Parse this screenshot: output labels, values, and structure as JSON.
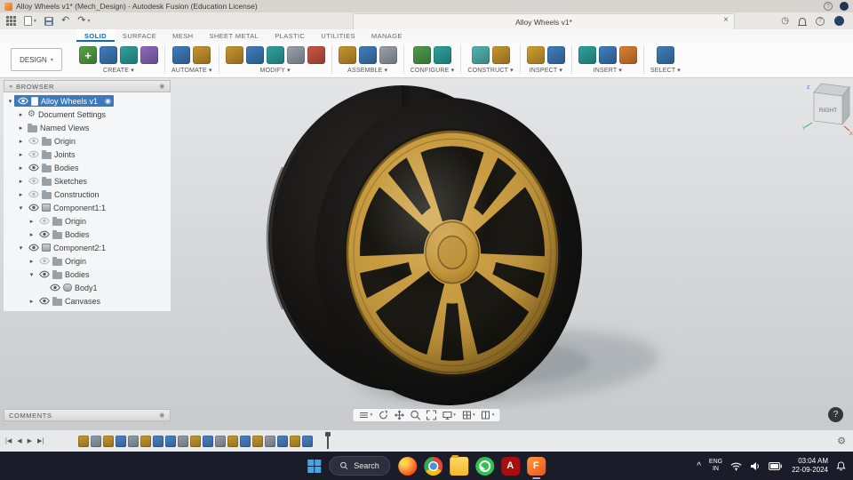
{
  "window": {
    "title": "Alloy Wheels v1* (Mech_Design) - Autodesk Fusion (Education License)"
  },
  "quickbar": {
    "tab": "Alloy Wheels v1*",
    "close_glyph": "×",
    "undo_glyph": "↶",
    "redo_glyph": "↷",
    "grid_menu": "app-grid",
    "clock_glyph": "◷"
  },
  "ribbon": {
    "workspace": "DESIGN",
    "workspace_caret": "▾",
    "tabs": [
      {
        "label": "SOLID",
        "active": true
      },
      {
        "label": "SURFACE"
      },
      {
        "label": "MESH"
      },
      {
        "label": "SHEET METAL"
      },
      {
        "label": "PLASTIC"
      },
      {
        "label": "UTILITIES"
      },
      {
        "label": "MANAGE"
      }
    ],
    "groups": [
      {
        "label": "CREATE",
        "icons": [
          {
            "name": "create-sketch",
            "color": "#55a546",
            "glyph": "+"
          },
          {
            "name": "extrude",
            "color": "#3f7fbf"
          },
          {
            "name": "revolve",
            "color": "#2fa3a0"
          },
          {
            "name": "create-form",
            "color": "#8f6abf"
          }
        ]
      },
      {
        "label": "AUTOMATE",
        "icons": [
          {
            "name": "automated-modeling",
            "color": "#3f7fbf"
          },
          {
            "name": "scripts-addins",
            "color": "#c9972f"
          }
        ]
      },
      {
        "label": "MODIFY",
        "icons": [
          {
            "name": "press-pull",
            "color": "#c9972f"
          },
          {
            "name": "fillet",
            "color": "#3f7fbf"
          },
          {
            "name": "shell",
            "color": "#2fa3a0"
          },
          {
            "name": "combine",
            "color": "#9aa2ab"
          },
          {
            "name": "move-copy",
            "color": "#cc5544"
          }
        ]
      },
      {
        "label": "ASSEMBLE",
        "icons": [
          {
            "name": "new-component",
            "color": "#c9972f"
          },
          {
            "name": "joint",
            "color": "#3f7fbf"
          },
          {
            "name": "rigid-group",
            "color": "#9aa2ab"
          }
        ]
      },
      {
        "label": "CONFIGURE",
        "icons": [
          {
            "name": "configuration",
            "color": "#4f9e4c"
          },
          {
            "name": "configure-table",
            "color": "#2fa3a0"
          }
        ]
      },
      {
        "label": "CONSTRUCT",
        "icons": [
          {
            "name": "construction-plane",
            "color": "#53b7b4"
          },
          {
            "name": "construction-axis",
            "color": "#c9972f"
          }
        ]
      },
      {
        "label": "INSPECT",
        "icons": [
          {
            "name": "measure",
            "color": "#d1a02f"
          },
          {
            "name": "section-analysis",
            "color": "#3f7fbf"
          }
        ]
      },
      {
        "label": "INSERT",
        "icons": [
          {
            "name": "insert-derive",
            "color": "#2fa3a0"
          },
          {
            "name": "decal",
            "color": "#3f7fbf"
          },
          {
            "name": "canvas",
            "color": "#e08030"
          }
        ]
      },
      {
        "label": "SELECT",
        "icons": [
          {
            "name": "select-tool",
            "color": "#3f7fbf"
          }
        ]
      }
    ]
  },
  "browser": {
    "header": "BROWSER",
    "items": [
      {
        "label": "Alloy Wheels v1",
        "level": 0,
        "icon": "document",
        "expand": "open",
        "eye": "on",
        "selected": true,
        "badge": true
      },
      {
        "label": "Document Settings",
        "level": 1,
        "icon": "gear",
        "expand": "closed",
        "eye": null
      },
      {
        "label": "Named Views",
        "level": 1,
        "icon": "folder",
        "expand": "closed",
        "eye": null
      },
      {
        "label": "Origin",
        "level": 1,
        "icon": "folder",
        "expand": "closed",
        "eye": "off"
      },
      {
        "label": "Joints",
        "level": 1,
        "icon": "folder",
        "expand": "closed",
        "eye": "off"
      },
      {
        "label": "Bodies",
        "level": 1,
        "icon": "folder",
        "expand": "closed",
        "eye": "on"
      },
      {
        "label": "Sketches",
        "level": 1,
        "icon": "folder",
        "expand": "closed",
        "eye": "off"
      },
      {
        "label": "Construction",
        "level": 1,
        "icon": "folder",
        "expand": "closed",
        "eye": "off"
      },
      {
        "label": "Component1:1",
        "level": 1,
        "icon": "component",
        "expand": "open",
        "eye": "on"
      },
      {
        "label": "Origin",
        "level": 2,
        "icon": "folder",
        "expand": "closed",
        "eye": "off"
      },
      {
        "label": "Bodies",
        "level": 2,
        "icon": "folder",
        "expand": "closed",
        "eye": "on"
      },
      {
        "label": "Component2:1",
        "level": 1,
        "icon": "component",
        "expand": "open",
        "eye": "on"
      },
      {
        "label": "Origin",
        "level": 2,
        "icon": "folder",
        "expand": "closed",
        "eye": "off"
      },
      {
        "label": "Bodies",
        "level": 2,
        "icon": "folder",
        "expand": "open",
        "eye": "on"
      },
      {
        "label": "Body1",
        "level": 3,
        "icon": "body",
        "expand": null,
        "eye": "on"
      },
      {
        "label": "Canvases",
        "level": 2,
        "icon": "folder",
        "expand": "closed",
        "eye": "on"
      }
    ]
  },
  "panels": {
    "collapse_glyph": "◂",
    "target_glyph": "◉"
  },
  "viewcube": {
    "face": "RIGHT",
    "axes": {
      "x": "X",
      "y": "Y",
      "z": "Z"
    }
  },
  "viewport": {
    "help_glyph": "?"
  },
  "comments": {
    "header": "COMMENTS"
  },
  "navbar": {
    "icons": [
      {
        "name": "file-menu",
        "caret": true
      },
      {
        "name": "orbit",
        "caret": false
      },
      {
        "name": "pan",
        "caret": false
      },
      {
        "name": "zoom",
        "caret": false
      },
      {
        "name": "fit",
        "caret": false
      },
      {
        "name": "display-settings",
        "caret": true
      },
      {
        "name": "grid-settings",
        "caret": true
      },
      {
        "name": "viewports",
        "caret": true
      }
    ]
  },
  "timeline": {
    "controls": [
      {
        "name": "go-to-start",
        "glyph": "|◀"
      },
      {
        "name": "step-back",
        "glyph": "◀"
      },
      {
        "name": "play",
        "glyph": "▶"
      },
      {
        "name": "go-to-end",
        "glyph": "▶|"
      }
    ],
    "features": [
      {
        "color": "#c99b2f"
      },
      {
        "color": "#97a1ab"
      },
      {
        "color": "#c99b2f"
      },
      {
        "color": "#4a86c8"
      },
      {
        "color": "#97a1ab"
      },
      {
        "color": "#c99b2f"
      },
      {
        "color": "#4a86c8"
      },
      {
        "color": "#4a86c8"
      },
      {
        "color": "#97a1ab"
      },
      {
        "color": "#c99b2f"
      },
      {
        "color": "#4a86c8"
      },
      {
        "color": "#97a1ab"
      },
      {
        "color": "#c99b2f"
      },
      {
        "color": "#4a86c8"
      },
      {
        "color": "#c99b2f"
      },
      {
        "color": "#97a1ab"
      },
      {
        "color": "#4a86c8"
      },
      {
        "color": "#c99b2f"
      },
      {
        "color": "#4a86c8"
      }
    ],
    "settings_glyph": "⚙"
  },
  "taskbar": {
    "search": "Search",
    "apps": [
      {
        "name": "firefox"
      },
      {
        "name": "chrome"
      },
      {
        "name": "files"
      },
      {
        "name": "whatsapp"
      },
      {
        "name": "acrobat",
        "letter": "A"
      },
      {
        "name": "fusion",
        "letter": "F",
        "active": true
      }
    ],
    "tray": {
      "chevron": "^",
      "lang_top": "ENG",
      "lang_bottom": "IN",
      "time": "03:04 AM",
      "date": "22-09-2024"
    }
  }
}
